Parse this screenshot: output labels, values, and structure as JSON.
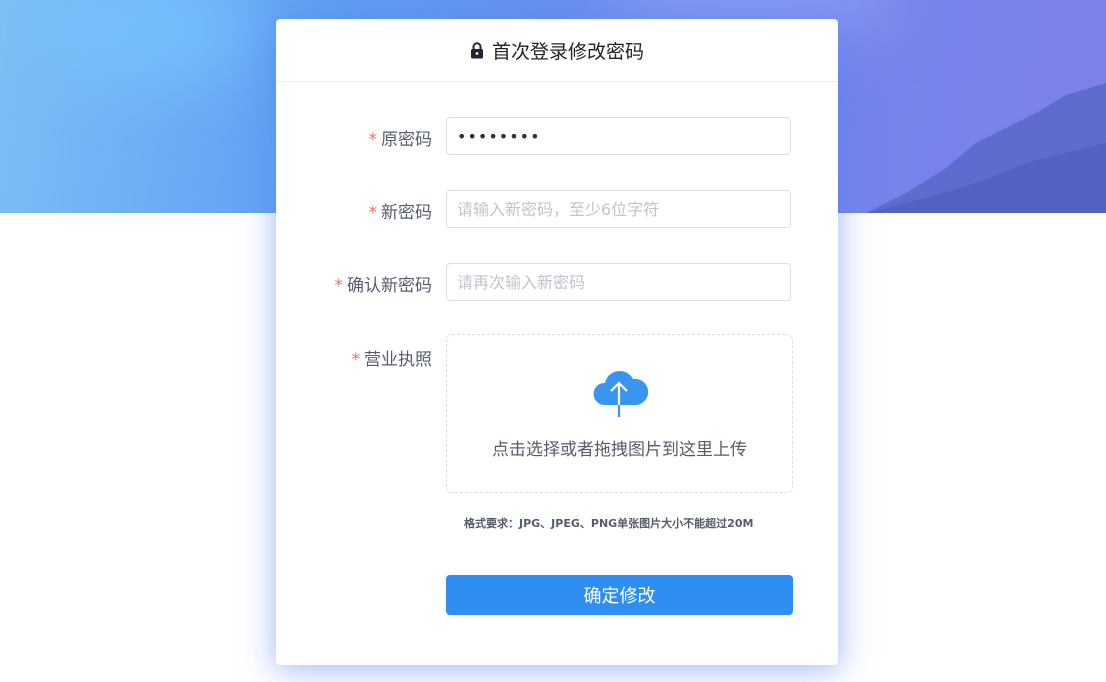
{
  "header": {
    "title": "首次登录修改密码",
    "icon": "lock-icon"
  },
  "form": {
    "old_password": {
      "label": "原密码",
      "required_mark": "*",
      "value": "••••••••"
    },
    "new_password": {
      "label": "新密码",
      "required_mark": "*",
      "placeholder": "请输入新密码，至少6位字符"
    },
    "confirm_password": {
      "label": "确认新密码",
      "required_mark": "*",
      "placeholder": "请再次输入新密码"
    },
    "license": {
      "label": "营业执照",
      "required_mark": "*",
      "upload_text": "点击选择或者拖拽图片到这里上传",
      "upload_icon": "cloud-upload-icon",
      "hint": "格式要求：JPG、JPEG、PNG单张图片大小不能超过20M"
    },
    "submit_label": "确定修改"
  },
  "colors": {
    "primary": "#2f8ef1",
    "required": "#f56c6c",
    "banner_start": "#7cc0f6",
    "banner_end": "#7f80ea"
  }
}
